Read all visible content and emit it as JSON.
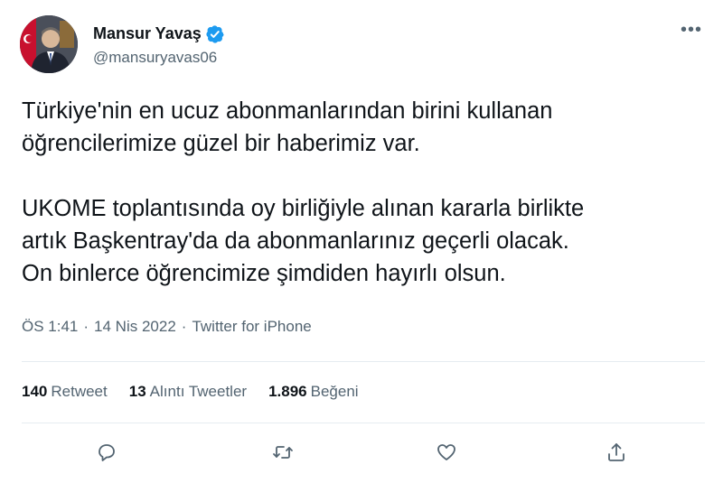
{
  "author": {
    "name": "Mansur Yavaş",
    "handle": "@mansuryavas06",
    "verified": true
  },
  "tweet": {
    "text": "Türkiye'nin en ucuz abonmanlarından birini kullanan\nöğrencilerimize güzel bir haberimiz var.\n\nUKOME toplantısında oy birliğiyle alınan kararla birlikte\nartık Başkentray'da da abonmanlarınız geçerli olacak.\nOn binlerce öğrencimize şimdiden hayırlı olsun.",
    "time": "ÖS 1:41",
    "date": "14 Nis 2022",
    "separator": "·",
    "source": "Twitter for iPhone"
  },
  "stats": {
    "retweets": {
      "count": "140",
      "label": "Retweet"
    },
    "quotes": {
      "count": "13",
      "label": "Alıntı Tweetler"
    },
    "likes": {
      "count": "1.896",
      "label": "Beğeni"
    }
  },
  "more_label": "•••",
  "colors": {
    "accent": "#1d9bf0",
    "text": "#0f1419",
    "secondary": "#536471",
    "divider": "#e6ecf0"
  },
  "actions": [
    "reply-icon",
    "retweet-icon",
    "like-icon",
    "share-icon"
  ]
}
